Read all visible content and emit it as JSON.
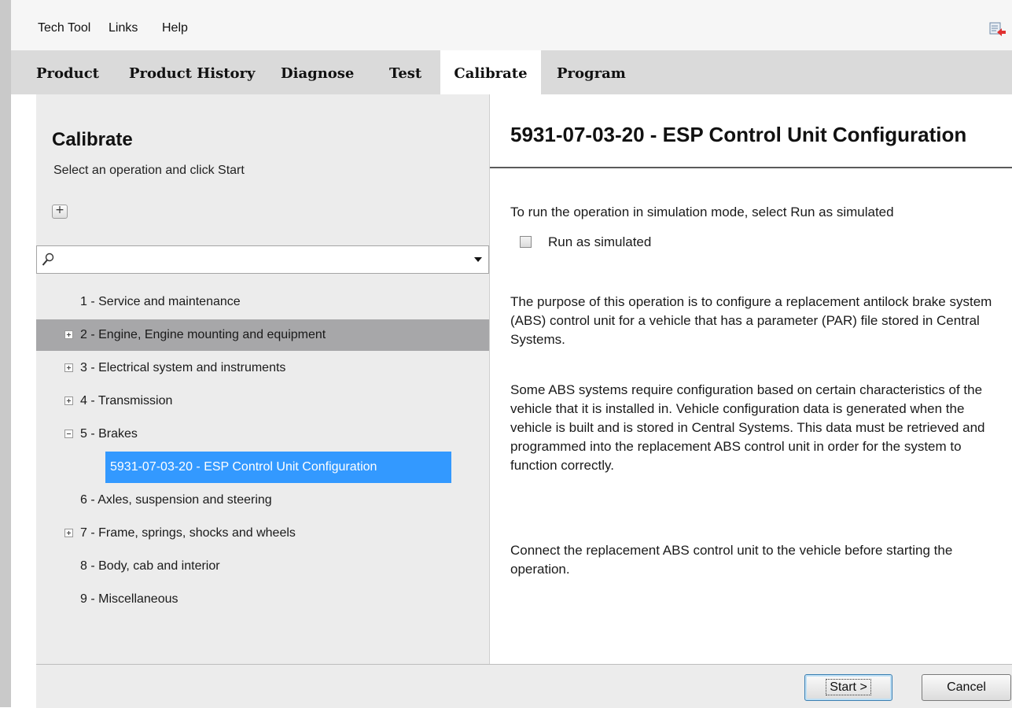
{
  "menubar": {
    "items": [
      "Tech Tool",
      "Links",
      "Help"
    ],
    "export_icon": "export-icon"
  },
  "tabs": {
    "active": "Calibrate",
    "items": [
      "Product",
      "Product History",
      "Diagnose",
      "Test",
      "Calibrate",
      "Program"
    ]
  },
  "left": {
    "title": "Calibrate",
    "subtitle": "Select an operation and click Start",
    "search": {
      "value": "",
      "placeholder": ""
    },
    "tree": [
      {
        "label": "1 - Service and maintenance",
        "toggle": "none"
      },
      {
        "label": "2 - Engine, Engine mounting and equipment",
        "toggle": "plus",
        "highlighted": true
      },
      {
        "label": "3 - Electrical system and instruments",
        "toggle": "plus"
      },
      {
        "label": "4 - Transmission",
        "toggle": "plus"
      },
      {
        "label": "5 - Brakes",
        "toggle": "minus",
        "expanded": true
      },
      {
        "label": "6 - Axles, suspension and steering",
        "toggle": "none"
      },
      {
        "label": "7 - Frame, springs, shocks and wheels",
        "toggle": "plus"
      },
      {
        "label": "8 - Body, cab and interior",
        "toggle": "none"
      },
      {
        "label": "9 - Miscellaneous",
        "toggle": "none"
      }
    ],
    "selected_child": "5931-07-03-20 - ESP Control Unit Configuration"
  },
  "right": {
    "title": "5931-07-03-20 - ESP Control Unit Configuration",
    "sim_instruction": "To run the operation in simulation mode, select Run as simulated",
    "sim_checkbox_label": "Run as simulated",
    "sim_checked": false,
    "description": [
      "The purpose of this operation is to configure a replacement antilock brake system (ABS) control unit for a vehicle that has a parameter (PAR) file stored in Central Systems.",
      "Some ABS systems require configuration based on certain characteristics of the vehicle that it is installed in. Vehicle configuration data is generated when the vehicle is built and is stored in Central Systems. This data must be retrieved and programmed into the replacement ABS control unit in order for the system to function correctly.",
      "Connect the replacement ABS control unit to the vehicle before starting the operation."
    ]
  },
  "buttons": {
    "start": "Start >",
    "cancel": "Cancel"
  },
  "colors": {
    "selection": "#3399ff",
    "row_highlight": "#a7a7a9",
    "tab_bar": "#dadada",
    "panel_bg": "#ececec"
  }
}
